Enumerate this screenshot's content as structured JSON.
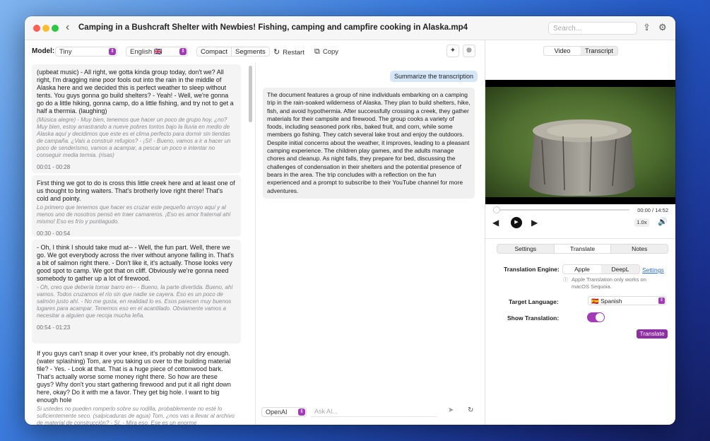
{
  "window": {
    "title": "Camping in a Bushcraft Shelter with Newbies! Fishing, camping and campfire cooking in Alaska.mp4",
    "search_placeholder": "Search..."
  },
  "toolbar": {
    "model_label": "Model:",
    "model_value": "Tiny",
    "language_value": "English 🇬🇧",
    "view_modes": [
      "Compact",
      "Segments"
    ],
    "restart_label": "Restart",
    "copy_label": "Copy"
  },
  "segments": [
    {
      "en": "(upbeat music) - All right, we gotta kinda group today, don't we? All right, I'm dragging nine poor fools out into the rain in the middle of Alaska here and we decided this is perfect weather to sleep without tents. You guys gonna go build shelters? - Yeah! - Well, we're gonna go do a little hiking, gonna camp, do a little fishing, and try not to get a half a thermia. (laughing)",
      "es": "(Música alegre) - Muy bien, tenemos que hacer un poco de grupo hoy, ¿no? Muy bien, estoy arrastrando a nueve pobres tontos bajo la lluvia en medio de Alaska aquí y decidimos que este es el clima perfecto para dormir sin tiendas de campaña. ¿Vais a construir refugios? - ¡Sí! - Bueno, vamos a ir a hacer un poco de senderismo, vamos a acampar, a pescar un poco e intentar no conseguir media termia. (risas)",
      "time": "00:01 - 00:28"
    },
    {
      "en": "First thing we got to do is cross this little creek here and at least one of us thought to bring waiters. That's brotherly love right there! That's cold and pointy.",
      "es": "Lo primero que tenemos que hacer es cruzar este pequeño arroyo aquí y al menos uno de nosotros pensó en traer camareros. ¡Eso es amor fraternal ahí mismo! Eso es frío y puntiagudo.",
      "time": "00:30 - 00:54"
    },
    {
      "en": "- Oh, I think I should take mud at-- - Well, the fun part. Well, there we go. We got everybody across the river without anyone falling in. That's a bit of salmon right there. - Don't like it, it's actually. Those looks very good spot to camp. We got that on cliff. Obviously we're gonna need somebody to gather up a lot of firewood.",
      "es": "- Oh, creo que debería tomar barro en-- - Bueno, la parte divertida. Bueno, ahí vamos. Todos cruzamos el río sin que nadie se cayera. Eso es un poco de salmón justo ahí. - No me gusta, en realidad lo es. Esos parecen muy buenos lugares para acampar. Tenemos eso en el acantilado. Obviamente vamos a necesitar a alguien que recoja mucha leña.",
      "time": "00:54 - 01:23"
    },
    {
      "en": "If you guys can't snap it over your knee, it's probably not dry enough. (water splashing) Tom, are you taking us over to the building material file? - Yes. - Look at that. That is a huge piece of cottonwood bark. That's actually worse some money right there. So how are these guys? Why don't you start gathering firewood and put it all right down here, okay? Do it with me a favor. They get big hole. I want to big enough hole",
      "es": "Si ustedes no pueden romperlo sobre su rodilla, probablemente no esté lo suficientemente seco. (salpicaduras de agua) Tom, ¿nos vas a llevar al archivo de material de construcción? - Sí. - Mira eso. Ese es un enorme",
      "time": ""
    }
  ],
  "chat": {
    "user_message": "Summarize the transcription",
    "ai_message": "The document features a group of nine individuals embarking on a camping trip in the rain-soaked wilderness of Alaska. They plan to build shelters, hike, fish, and avoid hypothermia. After successfully crossing a creek, they gather materials for their campsite and firewood. The group cooks a variety of foods, including seasoned pork ribs, baked fruit, and corn, while some members go fishing. They catch several lake trout and enjoy the outdoors. Despite initial concerns about the weather, it improves, leading to a pleasant camping experience. The children play games, and the adults manage chores and cleanup. As night falls, they prepare for bed, discussing the challenges of condensation in their shelters and the potential presence of bears in the area. The trip concludes with a reflection on the fun experienced and a prompt to subscribe to their YouTube channel for more adventures.",
    "provider": "OpenAI",
    "input_placeholder": "Ask AI..."
  },
  "player": {
    "tabs": [
      "Video",
      "Transcript"
    ],
    "time": "00:00 / 14:52",
    "speed": "1.0x",
    "progress": 0
  },
  "settings": {
    "tabs": [
      "Settings",
      "Translate",
      "Notes"
    ],
    "engine_label": "Translation Engine:",
    "engines": [
      "Apple",
      "DeepL"
    ],
    "settings_link": "Settings",
    "note": "Apple Translation only works on macOS Sequoia.",
    "target_label": "Target Language:",
    "target_value": "🇪🇸  Spanish",
    "show_label": "Show Translation:",
    "show_translation": true,
    "translate_button": "Translate"
  },
  "colors": {
    "accent": "#a33ab8",
    "link": "#2a6fd6"
  }
}
